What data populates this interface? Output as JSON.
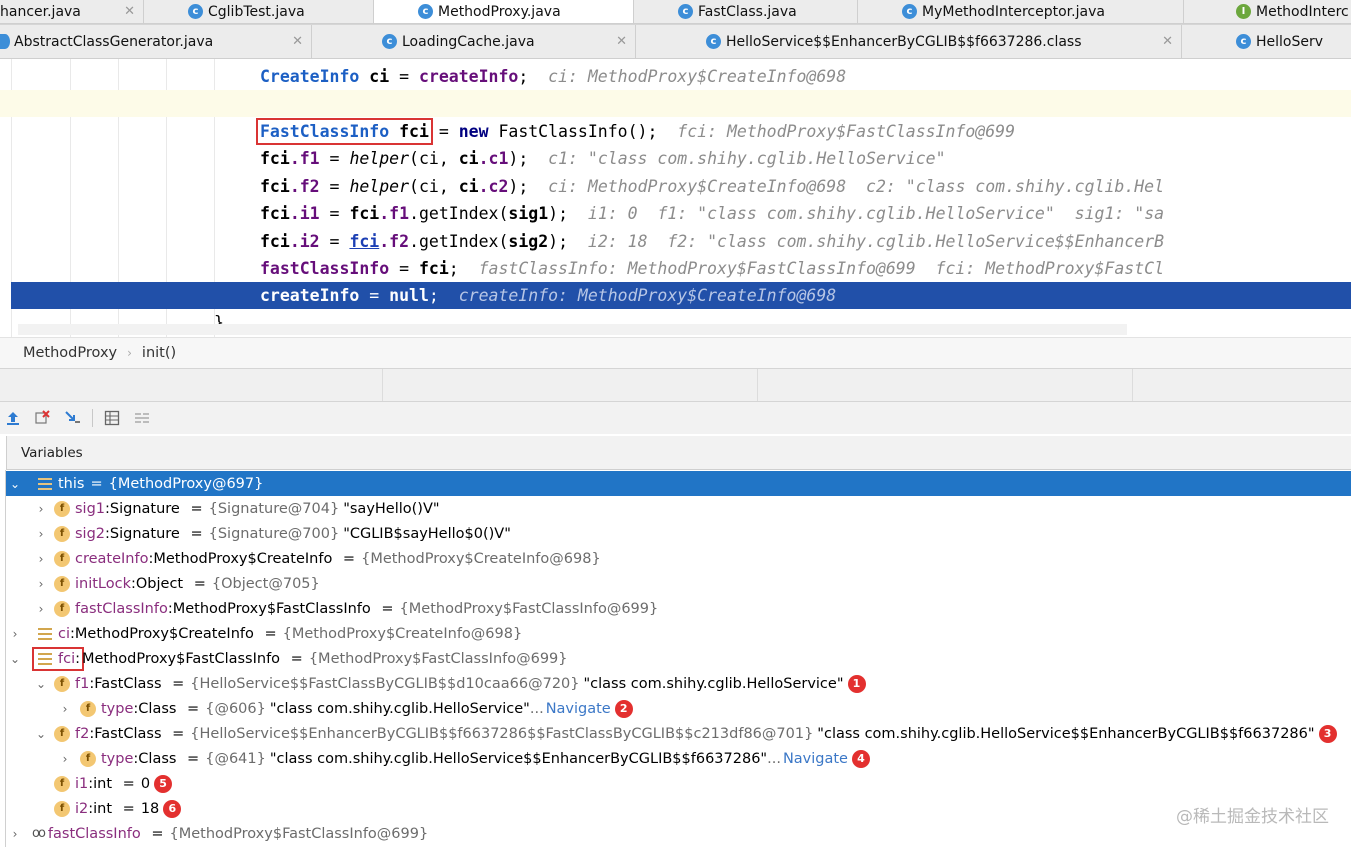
{
  "tabs_row1": [
    {
      "label": "hancer.java",
      "icon": "none"
    },
    {
      "label": "CglibTest.java",
      "icon": "class"
    },
    {
      "label": "MethodProxy.java",
      "icon": "class",
      "active": true
    },
    {
      "label": "FastClass.java",
      "icon": "class"
    },
    {
      "label": "MyMethodInterceptor.java",
      "icon": "class"
    },
    {
      "label": "MethodInterc",
      "icon": "interface"
    }
  ],
  "tabs_row2": [
    {
      "label": "AbstractClassGenerator.java"
    },
    {
      "label": "LoadingCache.java"
    },
    {
      "label": "HelloService$$EnhancerByCGLIB$$f6637286.class"
    },
    {
      "label": "HelloServ"
    }
  ],
  "code": {
    "l1": {
      "kw": "CreateInfo",
      "v": "ci",
      "eq": " = ",
      "call": "createInfo",
      "end": ";",
      "hint": "ci: MethodProxy$CreateInfo@698"
    },
    "l3": {
      "boxed": "FastClassInfo fci",
      "rest1": " = ",
      "kw_new": "new",
      "rest2": " FastClassInfo();",
      "hint": "fci: MethodProxy$FastClassInfo@699"
    },
    "l4": {
      "a": "fci",
      "b": ".f1",
      "c": " = ",
      "m": "helper",
      "d": "(ci, ",
      "e": "ci",
      "f": ".c1",
      "g": ");",
      "hint": "c1: \"class com.shihy.cglib.HelloService\""
    },
    "l5": {
      "a": "fci",
      "b": ".f2",
      "c": " = ",
      "m": "helper",
      "d": "(ci, ",
      "e": "ci",
      "f": ".c2",
      "g": ");",
      "hint": "ci: MethodProxy$CreateInfo@698  c2: \"class com.shihy.cglib.Hel"
    },
    "l6": {
      "a": "fci",
      "b": ".i1",
      "c": " = ",
      "d": "fci",
      "e": ".f1",
      "f": ".getIndex(",
      "g": "sig1",
      "h": ");",
      "hint": "i1: 0  f1: \"class com.shihy.cglib.HelloService\"  sig1: \"sa"
    },
    "l7": {
      "a": "fci",
      "b": ".i2",
      "c": " = ",
      "d": "fci",
      "e": ".f2",
      "f": ".getIndex(",
      "g": "sig2",
      "h": ");",
      "hint": "i2: 18  f2: \"class com.shihy.cglib.HelloService$$EnhancerB"
    },
    "l8": {
      "a": "fastClassInfo",
      "b": " = ",
      "c": "fci",
      "d": ";",
      "hint": "fastClassInfo: MethodProxy$FastClassInfo@699  fci: MethodProxy$FastCl"
    },
    "l9": {
      "a": "createInfo",
      "b": " = ",
      "c": "null",
      "d": ";",
      "hint": "createInfo: MethodProxy$CreateInfo@698"
    },
    "brace": "}"
  },
  "breadcrumb": {
    "cls": "MethodProxy",
    "method": "init()"
  },
  "vars_header": "Variables",
  "vars": [
    {
      "arrow": "v",
      "icon": "list",
      "name": "this",
      "type": "",
      "value": "{MethodProxy@697}",
      "str": "",
      "selected": true
    },
    {
      "arrow": ">",
      "icon": "f",
      "name": "sig1",
      "type": "Signature",
      "value": "{Signature@704}",
      "str": "\"sayHello()V\""
    },
    {
      "arrow": ">",
      "icon": "f",
      "name": "sig2",
      "type": "Signature",
      "value": "{Signature@700}",
      "str": "\"CGLIB$sayHello$0()V\""
    },
    {
      "arrow": ">",
      "icon": "f",
      "name": "createInfo",
      "type": "MethodProxy$CreateInfo",
      "value": "{MethodProxy$CreateInfo@698}",
      "str": ""
    },
    {
      "arrow": ">",
      "icon": "f",
      "name": "initLock",
      "type": "Object",
      "value": "{Object@705}",
      "str": ""
    },
    {
      "arrow": ">",
      "icon": "f",
      "name": "fastClassInfo",
      "type": "MethodProxy$FastClassInfo",
      "value": "{MethodProxy$FastClassInfo@699}",
      "str": ""
    },
    {
      "arrow": ">",
      "icon": "list",
      "name": "ci",
      "type": "MethodProxy$CreateInfo",
      "value": "{MethodProxy$CreateInfo@698}",
      "str": ""
    },
    {
      "arrow": "v",
      "icon": "list",
      "name": "fci",
      "type": "MethodProxy$FastClassInfo",
      "value": "{MethodProxy$FastClassInfo@699}",
      "str": ""
    },
    {
      "arrow": "v",
      "icon": "f",
      "name": "f1",
      "type": "FastClass",
      "value": "{HelloService$$FastClassByCGLIB$$d10caa66@720}",
      "str": "\"class com.shihy.cglib.HelloService\"",
      "badge": "1"
    },
    {
      "arrow": ">",
      "icon": "f",
      "name": "type",
      "type": "Class",
      "value": "{@606}",
      "str": "\"class com.shihy.cglib.HelloService\"",
      "ellipsis": "...",
      "nav": "Navigate",
      "badge": "2"
    },
    {
      "arrow": "v",
      "icon": "f",
      "name": "f2",
      "type": "FastClass",
      "value": "{HelloService$$EnhancerByCGLIB$$f6637286$$FastClassByCGLIB$$c213df86@701}",
      "str": "\"class com.shihy.cglib.HelloService$$EnhancerByCGLIB$$f6637286\"",
      "badge": "3"
    },
    {
      "arrow": ">",
      "icon": "f",
      "name": "type",
      "type": "Class",
      "value": "{@641}",
      "str": "\"class com.shihy.cglib.HelloService$$EnhancerByCGLIB$$f6637286\"",
      "ellipsis": "...",
      "nav": "Navigate",
      "badge": "4"
    },
    {
      "arrow": "",
      "icon": "f",
      "name": "i1",
      "type": "int",
      "value": "0",
      "str": "",
      "badge": "5"
    },
    {
      "arrow": "",
      "icon": "f",
      "name": "i2",
      "type": "int",
      "value": "18",
      "str": "",
      "badge": "6"
    },
    {
      "arrow": ">",
      "icon": "watch",
      "name": "fastClassInfo",
      "type": "",
      "value": "{MethodProxy$FastClassInfo@699}",
      "str": ""
    }
  ],
  "watermark": "@稀土掘金技术社区",
  "icons": {
    "tab_class": "class-icon",
    "tab_interface": "interface-icon",
    "field": "field-icon",
    "local": "local-variable-icon",
    "watch": "watch-icon"
  }
}
